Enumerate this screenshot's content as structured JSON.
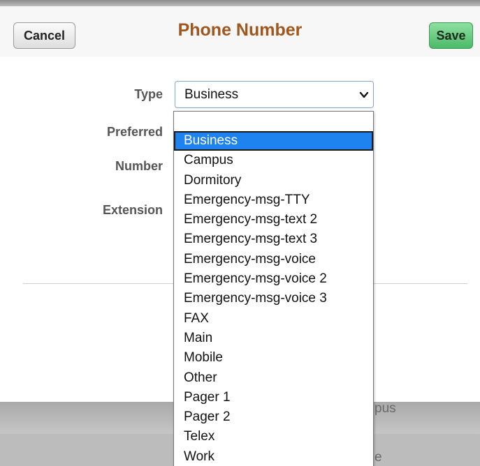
{
  "header": {
    "title": "Phone Number",
    "cancel_label": "Cancel",
    "save_label": "Save"
  },
  "form": {
    "type_label": "Type",
    "preferred_label": "Preferred",
    "number_label": "Number",
    "extension_label": "Extension",
    "type_selected": "Business"
  },
  "dropdown": {
    "options": [
      "Business",
      "Campus",
      "Dormitory",
      "Emergency-msg-TTY",
      "Emergency-msg-text 2",
      "Emergency-msg-text 3",
      "Emergency-msg-voice",
      "Emergency-msg-voice 2",
      "Emergency-msg-voice 3",
      "FAX",
      "Main",
      "Mobile",
      "Other",
      "Pager 1",
      "Pager 2",
      "Telex",
      "Work"
    ],
    "selected_index": 0
  },
  "background": {
    "peek_text_1": "pus",
    "peek_text_2": "e"
  },
  "colors": {
    "title": "#a0561d",
    "save_button": "#4cb968",
    "selected_option": "#1e82ef"
  }
}
